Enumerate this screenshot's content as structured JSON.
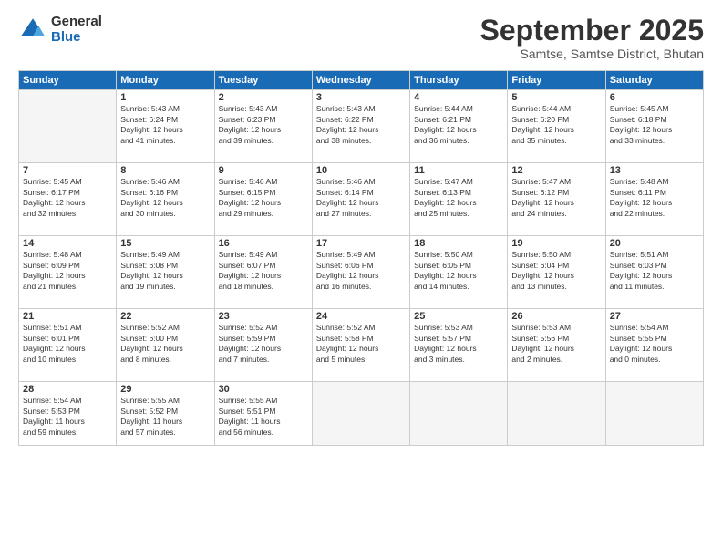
{
  "header": {
    "logo_general": "General",
    "logo_blue": "Blue",
    "month_title": "September 2025",
    "subtitle": "Samtse, Samtse District, Bhutan"
  },
  "days_of_week": [
    "Sunday",
    "Monday",
    "Tuesday",
    "Wednesday",
    "Thursday",
    "Friday",
    "Saturday"
  ],
  "weeks": [
    [
      {
        "day": "",
        "info": ""
      },
      {
        "day": "1",
        "info": "Sunrise: 5:43 AM\nSunset: 6:24 PM\nDaylight: 12 hours\nand 41 minutes."
      },
      {
        "day": "2",
        "info": "Sunrise: 5:43 AM\nSunset: 6:23 PM\nDaylight: 12 hours\nand 39 minutes."
      },
      {
        "day": "3",
        "info": "Sunrise: 5:43 AM\nSunset: 6:22 PM\nDaylight: 12 hours\nand 38 minutes."
      },
      {
        "day": "4",
        "info": "Sunrise: 5:44 AM\nSunset: 6:21 PM\nDaylight: 12 hours\nand 36 minutes."
      },
      {
        "day": "5",
        "info": "Sunrise: 5:44 AM\nSunset: 6:20 PM\nDaylight: 12 hours\nand 35 minutes."
      },
      {
        "day": "6",
        "info": "Sunrise: 5:45 AM\nSunset: 6:18 PM\nDaylight: 12 hours\nand 33 minutes."
      }
    ],
    [
      {
        "day": "7",
        "info": "Sunrise: 5:45 AM\nSunset: 6:17 PM\nDaylight: 12 hours\nand 32 minutes."
      },
      {
        "day": "8",
        "info": "Sunrise: 5:46 AM\nSunset: 6:16 PM\nDaylight: 12 hours\nand 30 minutes."
      },
      {
        "day": "9",
        "info": "Sunrise: 5:46 AM\nSunset: 6:15 PM\nDaylight: 12 hours\nand 29 minutes."
      },
      {
        "day": "10",
        "info": "Sunrise: 5:46 AM\nSunset: 6:14 PM\nDaylight: 12 hours\nand 27 minutes."
      },
      {
        "day": "11",
        "info": "Sunrise: 5:47 AM\nSunset: 6:13 PM\nDaylight: 12 hours\nand 25 minutes."
      },
      {
        "day": "12",
        "info": "Sunrise: 5:47 AM\nSunset: 6:12 PM\nDaylight: 12 hours\nand 24 minutes."
      },
      {
        "day": "13",
        "info": "Sunrise: 5:48 AM\nSunset: 6:11 PM\nDaylight: 12 hours\nand 22 minutes."
      }
    ],
    [
      {
        "day": "14",
        "info": "Sunrise: 5:48 AM\nSunset: 6:09 PM\nDaylight: 12 hours\nand 21 minutes."
      },
      {
        "day": "15",
        "info": "Sunrise: 5:49 AM\nSunset: 6:08 PM\nDaylight: 12 hours\nand 19 minutes."
      },
      {
        "day": "16",
        "info": "Sunrise: 5:49 AM\nSunset: 6:07 PM\nDaylight: 12 hours\nand 18 minutes."
      },
      {
        "day": "17",
        "info": "Sunrise: 5:49 AM\nSunset: 6:06 PM\nDaylight: 12 hours\nand 16 minutes."
      },
      {
        "day": "18",
        "info": "Sunrise: 5:50 AM\nSunset: 6:05 PM\nDaylight: 12 hours\nand 14 minutes."
      },
      {
        "day": "19",
        "info": "Sunrise: 5:50 AM\nSunset: 6:04 PM\nDaylight: 12 hours\nand 13 minutes."
      },
      {
        "day": "20",
        "info": "Sunrise: 5:51 AM\nSunset: 6:03 PM\nDaylight: 12 hours\nand 11 minutes."
      }
    ],
    [
      {
        "day": "21",
        "info": "Sunrise: 5:51 AM\nSunset: 6:01 PM\nDaylight: 12 hours\nand 10 minutes."
      },
      {
        "day": "22",
        "info": "Sunrise: 5:52 AM\nSunset: 6:00 PM\nDaylight: 12 hours\nand 8 minutes."
      },
      {
        "day": "23",
        "info": "Sunrise: 5:52 AM\nSunset: 5:59 PM\nDaylight: 12 hours\nand 7 minutes."
      },
      {
        "day": "24",
        "info": "Sunrise: 5:52 AM\nSunset: 5:58 PM\nDaylight: 12 hours\nand 5 minutes."
      },
      {
        "day": "25",
        "info": "Sunrise: 5:53 AM\nSunset: 5:57 PM\nDaylight: 12 hours\nand 3 minutes."
      },
      {
        "day": "26",
        "info": "Sunrise: 5:53 AM\nSunset: 5:56 PM\nDaylight: 12 hours\nand 2 minutes."
      },
      {
        "day": "27",
        "info": "Sunrise: 5:54 AM\nSunset: 5:55 PM\nDaylight: 12 hours\nand 0 minutes."
      }
    ],
    [
      {
        "day": "28",
        "info": "Sunrise: 5:54 AM\nSunset: 5:53 PM\nDaylight: 11 hours\nand 59 minutes."
      },
      {
        "day": "29",
        "info": "Sunrise: 5:55 AM\nSunset: 5:52 PM\nDaylight: 11 hours\nand 57 minutes."
      },
      {
        "day": "30",
        "info": "Sunrise: 5:55 AM\nSunset: 5:51 PM\nDaylight: 11 hours\nand 56 minutes."
      },
      {
        "day": "",
        "info": ""
      },
      {
        "day": "",
        "info": ""
      },
      {
        "day": "",
        "info": ""
      },
      {
        "day": "",
        "info": ""
      }
    ]
  ]
}
